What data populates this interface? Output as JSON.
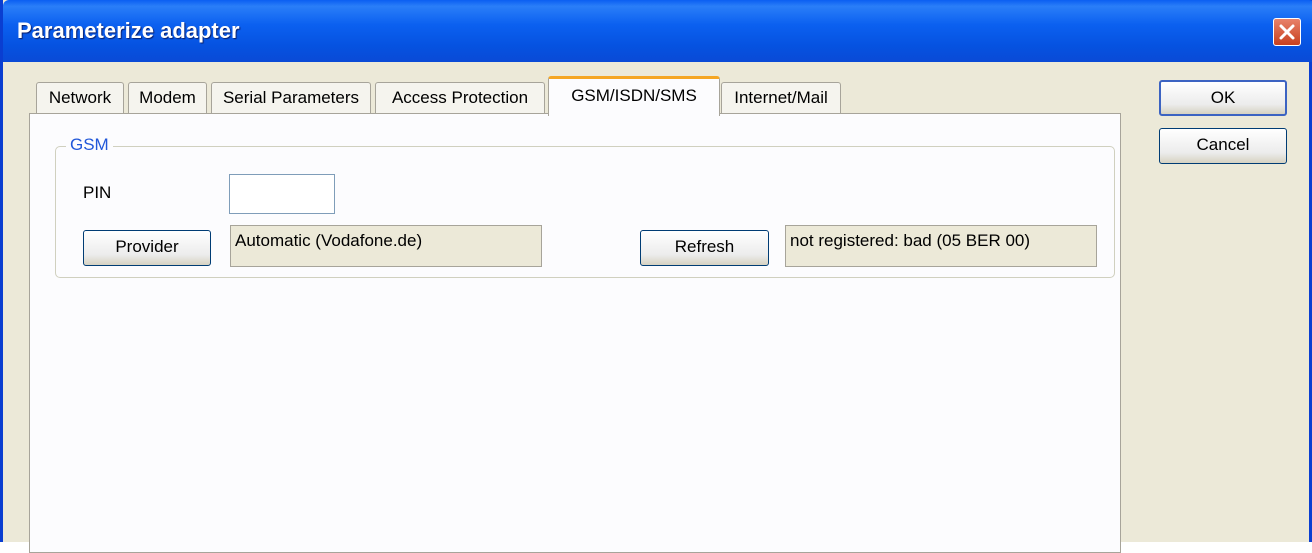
{
  "window": {
    "title": "Parameterize adapter"
  },
  "tabs": [
    {
      "label": "Network"
    },
    {
      "label": "Modem"
    },
    {
      "label": "Serial Parameters"
    },
    {
      "label": "Access Protection"
    },
    {
      "label": "GSM/ISDN/SMS",
      "active": true
    },
    {
      "label": "Internet/Mail"
    }
  ],
  "buttons": {
    "ok": "OK",
    "cancel": "Cancel"
  },
  "gsm": {
    "group_title": "GSM",
    "pin_label": "PIN",
    "pin_value": "",
    "provider_button": "Provider",
    "provider_value": "Automatic (Vodafone.de)",
    "refresh_button": "Refresh",
    "status_value": "not registered: bad (05 BER 00)"
  },
  "colors": {
    "titlebar": "#0a5ef2",
    "active_tab_accent": "#f5a623",
    "group_title": "#2157d9",
    "dialog_bg": "#ece9d8"
  },
  "icons": {
    "close": "close-icon"
  }
}
